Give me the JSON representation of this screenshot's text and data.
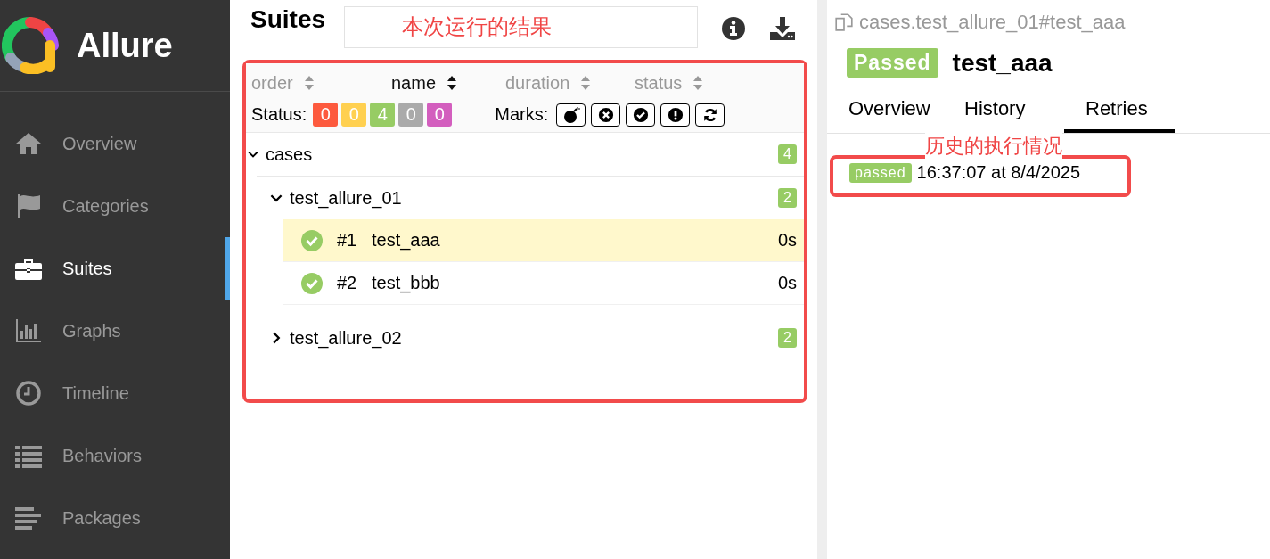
{
  "app": {
    "name": "Allure"
  },
  "sidebar": {
    "items": [
      {
        "label": "Overview",
        "selected": false
      },
      {
        "label": "Categories",
        "selected": false
      },
      {
        "label": "Suites",
        "selected": true
      },
      {
        "label": "Graphs",
        "selected": false
      },
      {
        "label": "Timeline",
        "selected": false
      },
      {
        "label": "Behaviors",
        "selected": false
      },
      {
        "label": "Packages",
        "selected": false
      }
    ]
  },
  "suites": {
    "title": "Suites",
    "note": "本次运行的结果",
    "highlighted": true,
    "sort": [
      {
        "label": "order",
        "selected": false
      },
      {
        "label": "name",
        "selected": true
      },
      {
        "label": "duration",
        "selected": false
      },
      {
        "label": "status",
        "selected": false
      }
    ],
    "status_label": "Status:",
    "status_counts": [
      {
        "count": "0",
        "color": "#fd5a3e"
      },
      {
        "count": "0",
        "color": "#ffd050"
      },
      {
        "count": "4",
        "color": "#97cc64"
      },
      {
        "count": "0",
        "color": "#aaaaaa"
      },
      {
        "count": "0",
        "color": "#d35ebe"
      }
    ],
    "marks_label": "Marks:",
    "marks": [
      {
        "kind": "bomb"
      },
      {
        "kind": "cross"
      },
      {
        "kind": "check"
      },
      {
        "kind": "exclamation"
      },
      {
        "kind": "refresh"
      }
    ],
    "tree": [
      {
        "name": "cases",
        "count": "4",
        "expanded": true,
        "children": [
          {
            "name": "test_allure_01",
            "count": "2",
            "expanded": true,
            "children": [
              {
                "number": "#1",
                "name": "test_aaa",
                "duration": "0s",
                "selected": true
              },
              {
                "number": "#2",
                "name": "test_bbb",
                "duration": "0s",
                "selected": false
              }
            ]
          },
          {
            "name": "test_allure_02",
            "count": "2",
            "expanded": false
          }
        ]
      }
    ]
  },
  "detail": {
    "path": "cases.test_allure_01#test_aaa",
    "status": "Passed",
    "title": "test_aaa",
    "tabs": [
      {
        "label": "Overview",
        "selected": false
      },
      {
        "label": "History",
        "selected": false
      },
      {
        "label": "Retries",
        "selected": true
      }
    ],
    "note": "历史的执行情况",
    "retries": {
      "highlighted": true,
      "items": [
        {
          "status": "passed",
          "time": "16:37:07 at 8/4/2025"
        }
      ]
    }
  }
}
